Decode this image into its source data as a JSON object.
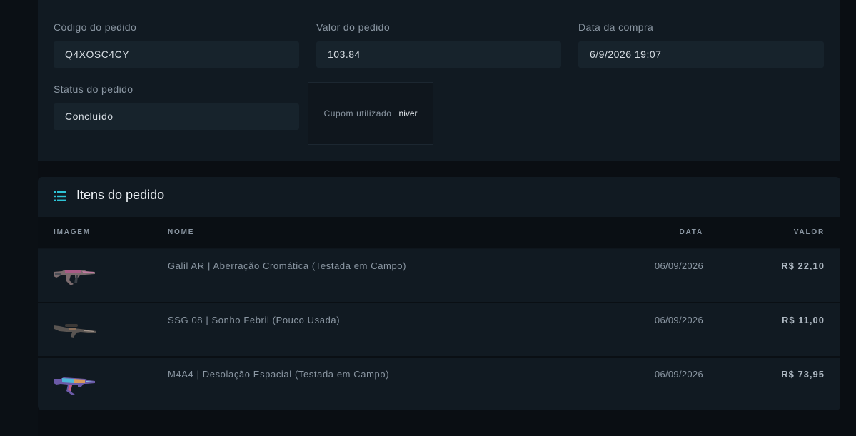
{
  "order": {
    "code_label": "Código do pedido",
    "code_value": "Q4XOSC4CY",
    "value_label": "Valor do pedido",
    "value_value": "103.84",
    "date_label": "Data da compra",
    "date_value": "6/9/2026 19:07",
    "status_label": "Status do pedido",
    "status_value": "Concluído",
    "coupon_label": "Cupom utilizado",
    "coupon_value": "niver"
  },
  "items": {
    "title": "Itens do pedido",
    "icon": "list-icon",
    "columns": {
      "image": "IMAGEM",
      "name": "NOME",
      "date": "DATA",
      "value": "VALOR"
    },
    "rows": [
      {
        "name": "Galil AR | Aberração Cromática (Testada em Campo)",
        "date": "06/09/2026",
        "value": "R$ 22,10",
        "image_icon": "rifle-galil-icon"
      },
      {
        "name": "SSG 08 | Sonho Febril (Pouco Usada)",
        "date": "06/09/2026",
        "value": "R$ 11,00",
        "image_icon": "rifle-ssg08-icon"
      },
      {
        "name": "M4A4 | Desolação Espacial (Testada em Campo)",
        "date": "06/09/2026",
        "value": "R$ 73,95",
        "image_icon": "rifle-m4a4-icon"
      }
    ]
  },
  "colors": {
    "accent": "#2ec4d6",
    "background": "#0a0e13",
    "card": "#111a22"
  }
}
